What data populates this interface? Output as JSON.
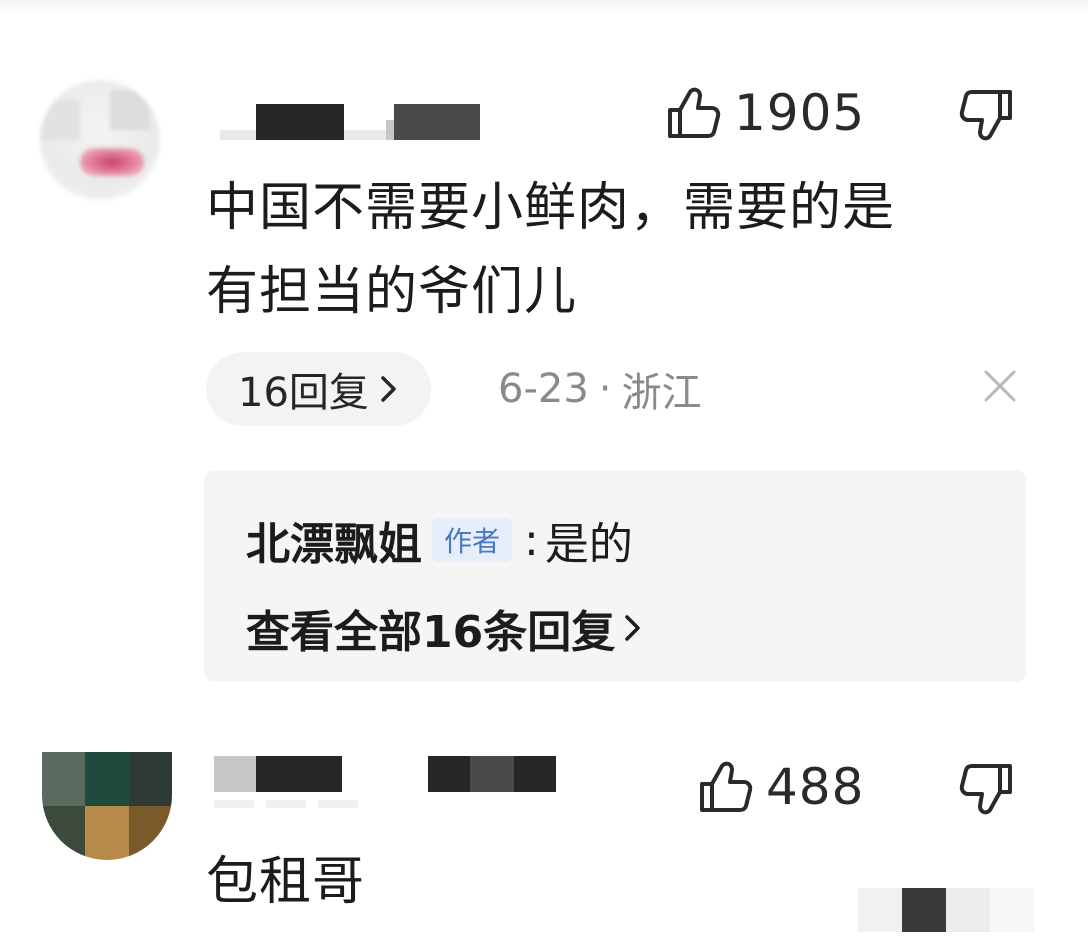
{
  "comments": [
    {
      "likes": "1905",
      "text_line1": "中国不需要小鲜肉，需要的是",
      "text_line2": "有担当的爷们儿",
      "reply_count_label": "16回复",
      "date": "6-23",
      "separator": "·",
      "location": "浙江",
      "reply_preview": {
        "author": "北漂飘姐",
        "badge": "作者",
        "colon": ":",
        "text": "是的",
        "view_all": "查看全部16条回复"
      }
    },
    {
      "likes": "488",
      "text_line1": "包租哥"
    }
  ],
  "icons": {
    "like": "thumbs-up-icon",
    "dislike": "thumbs-down-icon",
    "close": "close-icon",
    "chevron": "chevron-right-icon"
  },
  "colors": {
    "badge_bg": "#e6eefb",
    "badge_text": "#4a78c2",
    "meta_text": "#8a8a8a",
    "reply_bg": "#f5f5f5"
  }
}
